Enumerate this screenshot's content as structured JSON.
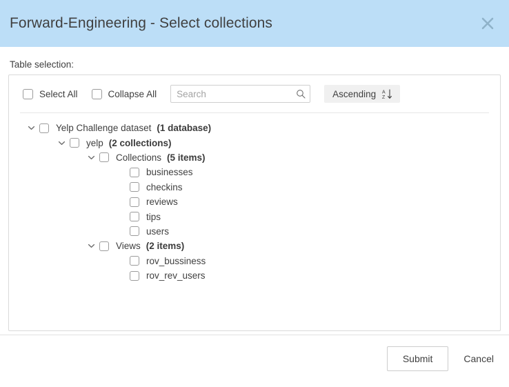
{
  "dialog": {
    "title": "Forward-Engineering - Select collections",
    "close_icon": "close-icon",
    "header_color": "#bcdef7"
  },
  "body": {
    "section_label": "Table selection:"
  },
  "toolbar": {
    "select_all_label": "Select All",
    "collapse_all_label": "Collapse All",
    "search": {
      "value": "",
      "placeholder": "Search",
      "icon": "search-icon"
    },
    "sort": {
      "label": "Ascending",
      "icon": "sort-ascending-icon"
    }
  },
  "tree": {
    "nodes": [
      {
        "label": "Yelp Challenge dataset",
        "count": "(1 database)",
        "level": 0,
        "expandable": true,
        "expanded": true,
        "checked": false
      },
      {
        "label": "yelp",
        "count": "(2 collections)",
        "level": 1,
        "expandable": true,
        "expanded": true,
        "checked": false
      },
      {
        "label": "Collections",
        "count": "(5 items)",
        "level": 2,
        "expandable": true,
        "expanded": true,
        "checked": false
      },
      {
        "label": "businesses",
        "count": "",
        "level": 3,
        "expandable": false,
        "expanded": false,
        "checked": false
      },
      {
        "label": "checkins",
        "count": "",
        "level": 3,
        "expandable": false,
        "expanded": false,
        "checked": false
      },
      {
        "label": "reviews",
        "count": "",
        "level": 3,
        "expandable": false,
        "expanded": false,
        "checked": false
      },
      {
        "label": "tips",
        "count": "",
        "level": 3,
        "expandable": false,
        "expanded": false,
        "checked": false
      },
      {
        "label": "users",
        "count": "",
        "level": 3,
        "expandable": false,
        "expanded": false,
        "checked": false
      },
      {
        "label": "Views",
        "count": "(2 items)",
        "level": 2,
        "expandable": true,
        "expanded": true,
        "checked": false
      },
      {
        "label": "rov_bussiness",
        "count": "",
        "level": 3,
        "expandable": false,
        "expanded": false,
        "checked": false
      },
      {
        "label": "rov_rev_users",
        "count": "",
        "level": 3,
        "expandable": false,
        "expanded": false,
        "checked": false
      }
    ]
  },
  "footer": {
    "submit_label": "Submit",
    "cancel_label": "Cancel"
  }
}
